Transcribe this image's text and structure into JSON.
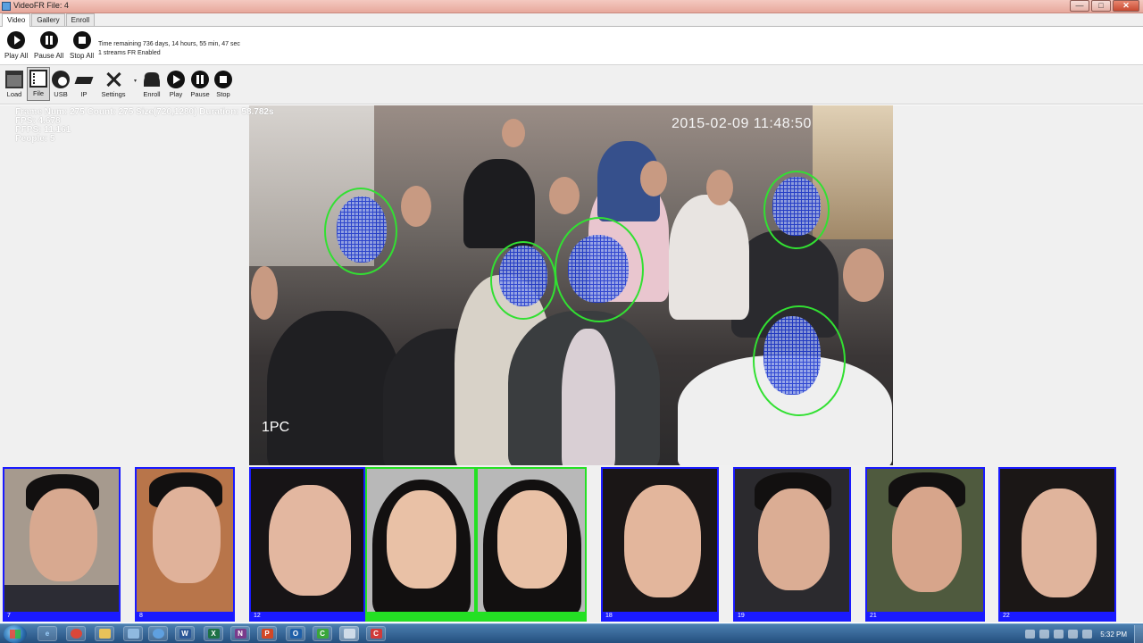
{
  "window": {
    "title": "VideoFR File: 4",
    "buttons": [
      "minimize",
      "maximize",
      "close"
    ]
  },
  "tabs": [
    {
      "label": "Video",
      "active": true
    },
    {
      "label": "Gallery",
      "active": false
    },
    {
      "label": "Enroll",
      "active": false
    }
  ],
  "controls": {
    "play_all": "Play All",
    "pause_all": "Pause All",
    "stop_all": "Stop All"
  },
  "status": {
    "time_remaining": "Time remaining 736 days, 14 hours, 55 min, 47 sec",
    "streams": "1 streams FR Enabled"
  },
  "toolbar": {
    "load": "Load",
    "file": "File",
    "usb": "USB",
    "ip": "IP",
    "settings": "Settings",
    "enroll": "Enroll",
    "play": "Play",
    "pause": "Pause",
    "stop": "Stop"
  },
  "overlay": {
    "frame": "Frame Num: 275 Count: 275 Size(720,1280) Duration: 58.782s",
    "fps": "FPS: 4.678",
    "pfps": "PFPS: 11.161",
    "people": "People: 5"
  },
  "video": {
    "timestamp": "2015-02-09 11:48:50",
    "camera": "1PC"
  },
  "thumbnails": [
    {
      "id": "7",
      "match": false
    },
    {
      "id": "8",
      "match": false
    },
    {
      "id": "12",
      "match": false
    },
    {
      "id": "",
      "match": true
    },
    {
      "id": "",
      "match": true
    },
    {
      "id": "18",
      "match": false
    },
    {
      "id": "19",
      "match": false
    },
    {
      "id": "21",
      "match": false
    },
    {
      "id": "22",
      "match": false
    }
  ],
  "taskbar": {
    "apps": [
      "ie-icon",
      "chrome-icon",
      "explorer-icon",
      "files-icon",
      "messenger-icon",
      "word-icon",
      "excel-icon",
      "onenote-icon",
      "powerpoint-icon",
      "outlook-icon",
      "app-c-icon",
      "videofr-icon",
      "app-c2-icon"
    ],
    "clock": "5:32 PM"
  },
  "colors": {
    "thumb_border": "#1a1aff",
    "match_border": "#24e024",
    "face_ring": "#32e032",
    "mesh": "#1f3ad0",
    "taskbar": "#244f7e"
  }
}
